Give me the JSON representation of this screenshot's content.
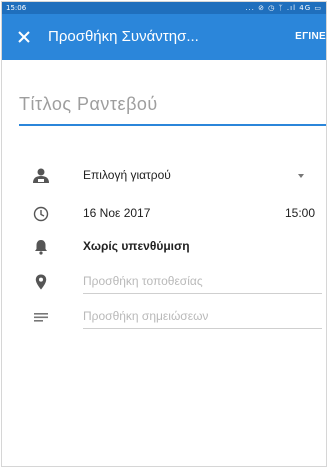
{
  "status_bar": {
    "time": "15:06",
    "icons": "... ⊘ ◷ ᛉ .ıl 4G ▭"
  },
  "app_bar": {
    "title": "Προσθήκη Συνάντησ...",
    "done_label": "ΕΓΙΝΕ"
  },
  "title_field": {
    "placeholder": "Τίτλος Ραντεβού"
  },
  "doctor": {
    "label": "Επιλογή γιατρού"
  },
  "datetime": {
    "date": "16 Νοε 2017",
    "time": "15:00"
  },
  "reminder": {
    "label": "Χωρίς υπενθύμιση"
  },
  "location": {
    "placeholder": "Προσθήκη τοποθεσίας"
  },
  "notes": {
    "placeholder": "Προσθήκη σημειώσεων"
  },
  "colors": {
    "accent": "#2b86da",
    "status_bar": "#1f6fbd",
    "icon_gray": "#555555"
  },
  "icons": [
    "close-icon",
    "doctor-icon",
    "clock-icon",
    "bell-icon",
    "location-pin-icon",
    "notes-icon",
    "chevron-down-icon"
  ]
}
